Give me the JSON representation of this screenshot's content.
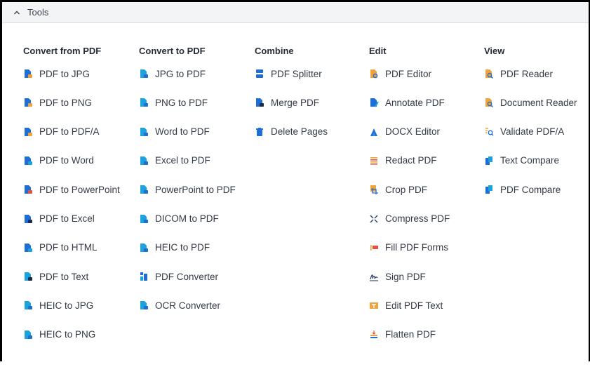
{
  "header": {
    "title": "Tools",
    "collapse_icon": "chevron-up-icon"
  },
  "columns": [
    {
      "heading": "Convert from PDF",
      "items": [
        {
          "label": "PDF to JPG",
          "icon": "pdf-to-jpg-icon"
        },
        {
          "label": "PDF to PNG",
          "icon": "pdf-to-png-icon"
        },
        {
          "label": "PDF to PDF/A",
          "icon": "pdf-to-pdfa-icon"
        },
        {
          "label": "PDF to Word",
          "icon": "pdf-to-word-icon"
        },
        {
          "label": "PDF to PowerPoint",
          "icon": "pdf-to-powerpoint-icon"
        },
        {
          "label": "PDF to Excel",
          "icon": "pdf-to-excel-icon"
        },
        {
          "label": "PDF to HTML",
          "icon": "pdf-to-html-icon"
        },
        {
          "label": "PDF to Text",
          "icon": "pdf-to-text-icon"
        },
        {
          "label": "HEIC to JPG",
          "icon": "heic-to-jpg-icon"
        },
        {
          "label": "HEIC to PNG",
          "icon": "heic-to-png-icon"
        }
      ]
    },
    {
      "heading": "Convert to PDF",
      "items": [
        {
          "label": "JPG to PDF",
          "icon": "jpg-to-pdf-icon"
        },
        {
          "label": "PNG to PDF",
          "icon": "png-to-pdf-icon"
        },
        {
          "label": "Word to PDF",
          "icon": "word-to-pdf-icon"
        },
        {
          "label": "Excel to PDF",
          "icon": "excel-to-pdf-icon"
        },
        {
          "label": "PowerPoint to PDF",
          "icon": "powerpoint-to-pdf-icon"
        },
        {
          "label": "DICOM to PDF",
          "icon": "dicom-to-pdf-icon"
        },
        {
          "label": "HEIC to PDF",
          "icon": "heic-to-pdf-icon"
        },
        {
          "label": "PDF Converter",
          "icon": "pdf-converter-icon"
        },
        {
          "label": "OCR Converter",
          "icon": "ocr-converter-icon"
        }
      ]
    },
    {
      "heading": "Combine",
      "items": [
        {
          "label": "PDF Splitter",
          "icon": "pdf-splitter-icon"
        },
        {
          "label": "Merge PDF",
          "icon": "merge-pdf-icon"
        },
        {
          "label": "Delete Pages",
          "icon": "trash-icon"
        }
      ]
    },
    {
      "heading": "Edit",
      "items": [
        {
          "label": "PDF Editor",
          "icon": "pdf-editor-icon"
        },
        {
          "label": "Annotate PDF",
          "icon": "annotate-pdf-icon"
        },
        {
          "label": "DOCX Editor",
          "icon": "docx-editor-icon"
        },
        {
          "label": "Redact PDF",
          "icon": "redact-pdf-icon"
        },
        {
          "label": "Crop PDF",
          "icon": "crop-pdf-icon"
        },
        {
          "label": "Compress PDF",
          "icon": "compress-pdf-icon"
        },
        {
          "label": "Fill PDF Forms",
          "icon": "fill-pdf-forms-icon"
        },
        {
          "label": "Sign PDF",
          "icon": "signature-icon"
        },
        {
          "label": "Edit PDF Text",
          "icon": "edit-pdf-text-icon"
        },
        {
          "label": "Flatten PDF",
          "icon": "flatten-pdf-icon"
        }
      ]
    },
    {
      "heading": "View",
      "items": [
        {
          "label": "PDF Reader",
          "icon": "pdf-reader-icon"
        },
        {
          "label": "Document Reader",
          "icon": "document-reader-icon"
        },
        {
          "label": "Validate PDF/A",
          "icon": "validate-pdfa-icon"
        },
        {
          "label": "Text Compare",
          "icon": "text-compare-icon"
        },
        {
          "label": "PDF Compare",
          "icon": "pdf-compare-icon"
        }
      ]
    }
  ],
  "colors": {
    "blue": "#1e6ed6",
    "cyan": "#1ca3de",
    "orange": "#f0a33a",
    "red": "#e8513b",
    "header_bg": "#f3f4f6"
  }
}
